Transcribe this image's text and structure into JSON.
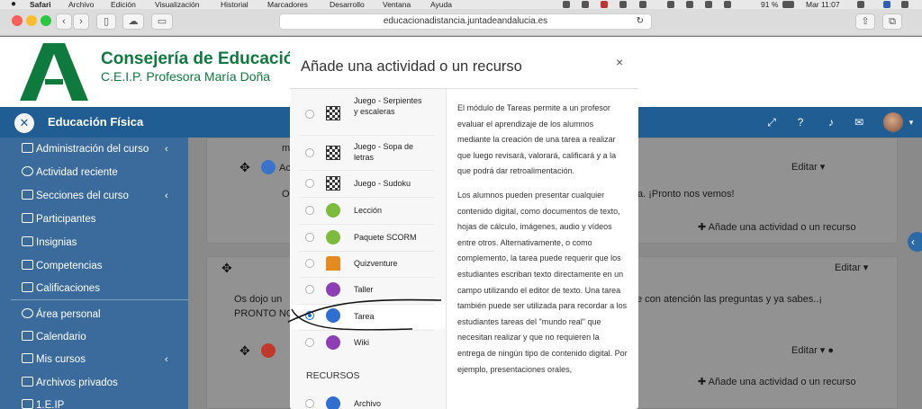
{
  "menubar": {
    "items": [
      "Safari",
      "Archivo",
      "Edición",
      "Visualización",
      "Historial",
      "Marcadores",
      "Desarrollo",
      "Ventana",
      "Ayuda"
    ],
    "battery": "91 %",
    "clock": "Mar 11:07"
  },
  "browser": {
    "url": "educacionadistancia.juntadeandalucia.es"
  },
  "site": {
    "title": "Consejería de Educació",
    "subtitle": "C.E.I.P. Profesora María Doña"
  },
  "course": {
    "name": "Educación Física"
  },
  "sidebar": {
    "items": [
      {
        "label": "Administración del curso",
        "has_chevron": true
      },
      {
        "label": "Actividad reciente"
      },
      {
        "label": "Secciones del curso",
        "has_chevron": true
      },
      {
        "label": "Participantes"
      },
      {
        "label": "Insignias"
      },
      {
        "label": "Competencias"
      },
      {
        "label": "Calificaciones"
      },
      {
        "label": "Área personal"
      },
      {
        "label": "Calendario"
      },
      {
        "label": "Mis cursos",
        "has_chevron": true
      },
      {
        "label": "Archivos privados"
      },
      {
        "label": "1.E.IP"
      }
    ]
  },
  "content": {
    "edit_label": "Editar",
    "add_activity": "Añade una actividad o un recurso",
    "snippet_m": "m",
    "snippet_ac": "Ac",
    "snippet_o": "O",
    "snippet_right1": "a. ¡Pronto nos vemos!",
    "snippet_left2a": "Os dojo un",
    "snippet_left2b": "PRONTO NO",
    "snippet_right2": "e con atención las preguntas y ya sabes..¡"
  },
  "modal": {
    "title": "Añade una actividad o un recurso",
    "close": "×",
    "options": [
      {
        "label": "Juego - Serpientes y escaleras",
        "icon": "grid-game-icon",
        "selected": false
      },
      {
        "label": "Juego - Sopa de letras",
        "icon": "grid-game-icon",
        "selected": false
      },
      {
        "label": "Juego - Sudoku",
        "icon": "grid-game-icon",
        "selected": false
      },
      {
        "label": "Lección",
        "icon": "lesson-icon",
        "selected": false
      },
      {
        "label": "Paquete SCORM",
        "icon": "scorm-icon",
        "selected": false
      },
      {
        "label": "Quizventure",
        "icon": "quizventure-icon",
        "selected": false
      },
      {
        "label": "Taller",
        "icon": "workshop-icon",
        "selected": false
      },
      {
        "label": "Tarea",
        "icon": "assignment-icon",
        "selected": true
      },
      {
        "label": "Wiki",
        "icon": "wiki-icon",
        "selected": false
      }
    ],
    "resources_header": "RECURSOS",
    "resources": [
      {
        "label": "Archivo",
        "icon": "file-icon",
        "selected": false
      }
    ],
    "description": [
      "El módulo de Tareas permite a un profesor evaluar el aprendizaje de los alumnos mediante la creación de una tarea a realizar que luego revisará, valorará, calificará y a la que podrá dar retroalimentación.",
      "Los alumnos pueden presentar cualquier contenido digital, como documentos de texto, hojas de cálculo, imágenes, audio y vídeos entre otros. Alternativamente, o como complemento, la tarea puede requerir que los estudiantes escriban texto directamente en un campo utilizando el editor de texto. Una tarea también puede ser utilizada para recordar a los estudiantes tareas del \"mundo real\" que necesitan realizar y que no requieren la entrega de ningún tipo de contenido digital. Por ejemplo, presentaciones orales,"
    ]
  },
  "colors": {
    "navbar": "#1f5d92",
    "drawer": "#3b6b9c",
    "brand_green": "#0f7a3e",
    "selected_radio": "#1a6ed8"
  }
}
